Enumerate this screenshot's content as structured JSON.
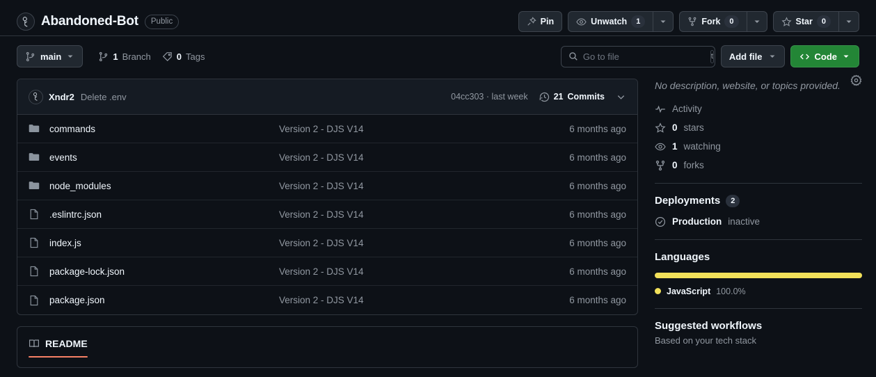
{
  "header": {
    "repo_name": "Abandoned-Bot",
    "visibility": "Public",
    "avatar_icon": "user-avatar-icon",
    "actions": {
      "pin_label": "Pin",
      "pin_icon": "pin-icon",
      "unwatch_label": "Unwatch",
      "unwatch_count": "1",
      "unwatch_icon": "eye-icon",
      "fork_label": "Fork",
      "fork_count": "0",
      "fork_icon": "repo-forked-icon",
      "star_label": "Star",
      "star_count": "0",
      "star_icon": "star-icon",
      "caret_icon": "triangle-down-icon"
    }
  },
  "toolbar": {
    "branch_label": "main",
    "branch_icon": "git-branch-icon",
    "branch_caret_icon": "triangle-down-icon",
    "branches_count": "1",
    "branches_label": "Branch",
    "branches_icon": "git-branch-icon",
    "tags_count": "0",
    "tags_label": "Tags",
    "tags_icon": "tag-icon",
    "search_placeholder": "Go to file",
    "search_value": "",
    "search_icon": "search-icon",
    "search_shortcut": "t",
    "add_file_label": "Add file",
    "code_label": "Code",
    "code_icon": "code-icon"
  },
  "commit_bar": {
    "author_avatar_icon": "user-avatar-icon",
    "author": "Xndr2",
    "message": "Delete .env",
    "sha_and_time": "04cc303 · last week",
    "history_icon": "history-icon",
    "commits_count": "21",
    "commits_label": "Commits",
    "collapse_icon": "chevron-down-icon"
  },
  "files": {
    "rows": [
      {
        "name": "commands",
        "type": "folder",
        "commit": "Version 2 - DJS V14",
        "age": "6 months ago"
      },
      {
        "name": "events",
        "type": "folder",
        "commit": "Version 2 - DJS V14",
        "age": "6 months ago"
      },
      {
        "name": "node_modules",
        "type": "folder",
        "commit": "Version 2 - DJS V14",
        "age": "6 months ago"
      },
      {
        "name": ".eslintrc.json",
        "type": "file",
        "commit": "Version 2 - DJS V14",
        "age": "6 months ago"
      },
      {
        "name": "index.js",
        "type": "file",
        "commit": "Version 2 - DJS V14",
        "age": "6 months ago"
      },
      {
        "name": "package-lock.json",
        "type": "file",
        "commit": "Version 2 - DJS V14",
        "age": "6 months ago"
      },
      {
        "name": "package.json",
        "type": "file",
        "commit": "Version 2 - DJS V14",
        "age": "6 months ago"
      }
    ]
  },
  "readme": {
    "tab_label": "README",
    "tab_icon": "book-icon",
    "accent_color": "#f78166"
  },
  "sidebar": {
    "description": "No description, website, or topics provided.",
    "settings_icon": "gear-icon",
    "stats": [
      {
        "icon": "pulse-icon",
        "value": "",
        "label": "Activity"
      },
      {
        "icon": "star-icon",
        "value": "0",
        "label": "stars"
      },
      {
        "icon": "eye-icon",
        "value": "1",
        "label": "watching"
      },
      {
        "icon": "repo-forked-icon",
        "value": "0",
        "label": "forks"
      }
    ],
    "deployments": {
      "title": "Deployments",
      "count": "2",
      "items": [
        {
          "icon": "check-circle-icon",
          "name": "Production",
          "state": "inactive"
        }
      ]
    },
    "languages": {
      "title": "Languages",
      "items": [
        {
          "name": "JavaScript",
          "percent": "100.0%",
          "value": 100,
          "color": "#f1e05a"
        }
      ]
    },
    "workflows": {
      "title": "Suggested workflows",
      "subtitle": "Based on your tech stack"
    }
  }
}
